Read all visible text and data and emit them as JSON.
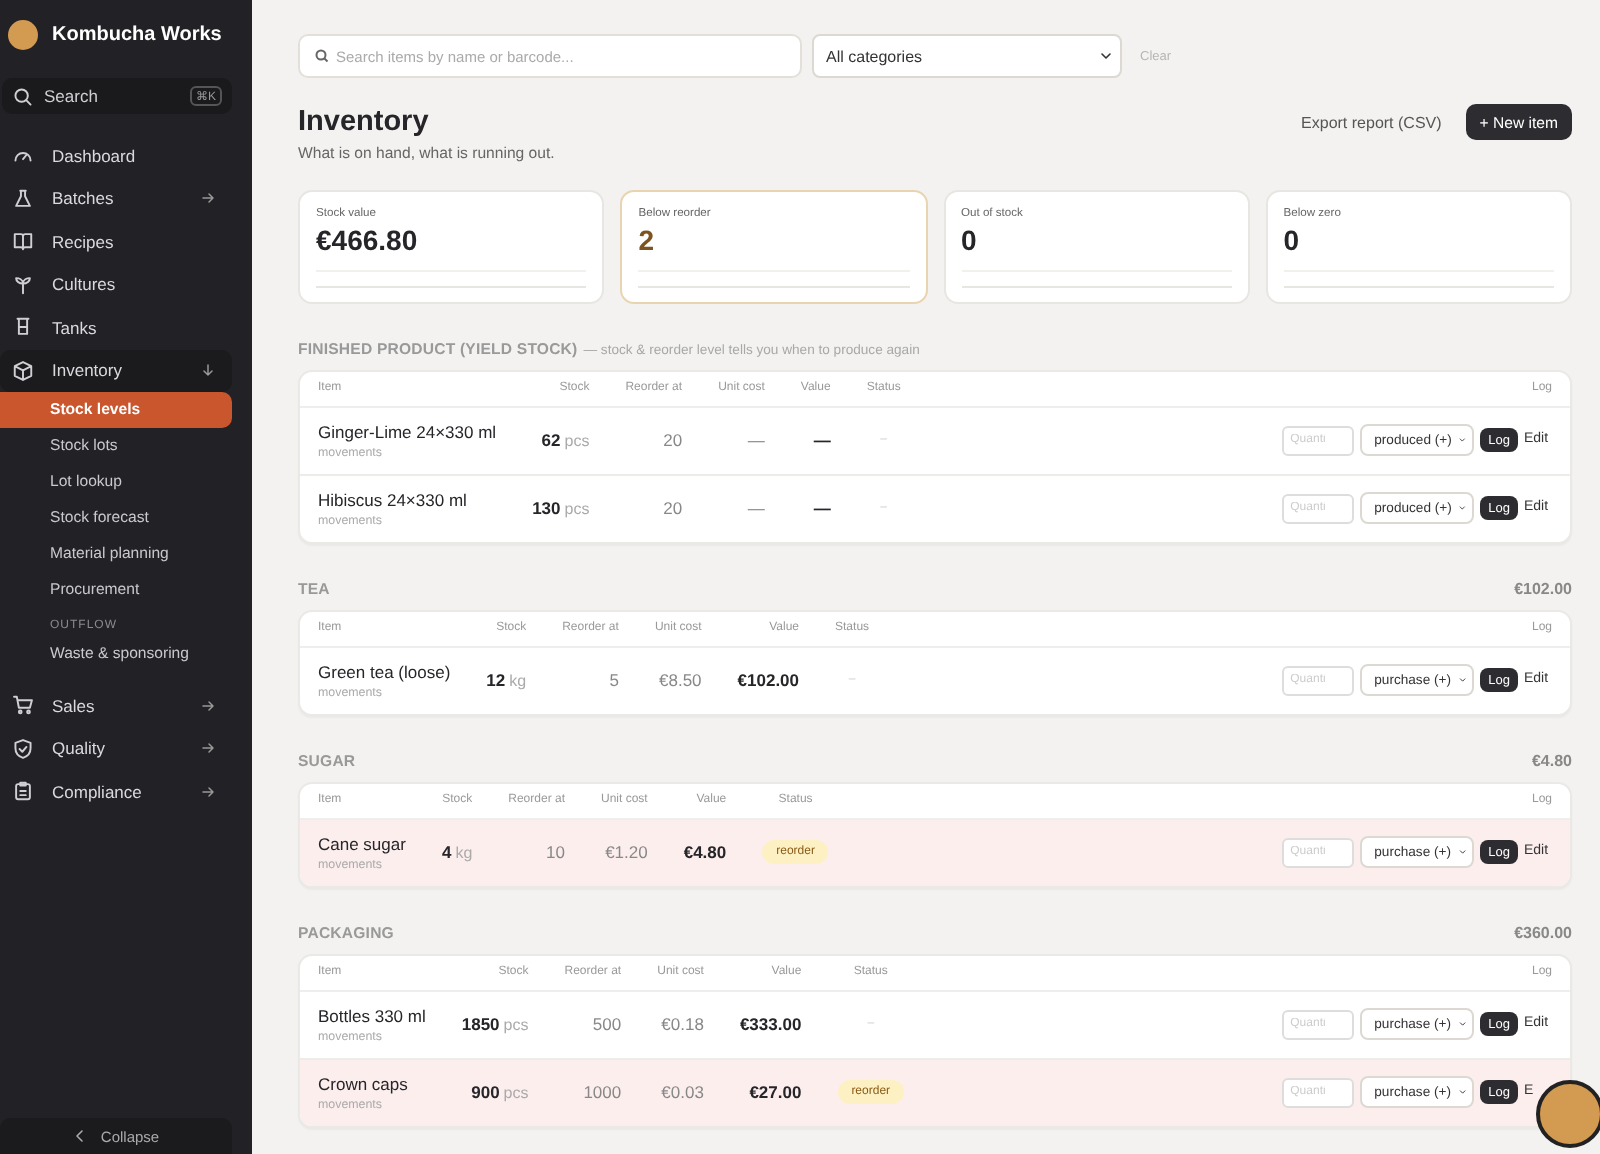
{
  "sidebar": {
    "brand": "Kombucha Works",
    "search": {
      "label": "Search",
      "shortcut": "⌘K"
    },
    "nav": [
      {
        "label": "Dashboard"
      },
      {
        "label": "Batches",
        "expanded": false
      },
      {
        "label": "Recipes"
      },
      {
        "label": "Cultures"
      },
      {
        "label": "Tanks"
      },
      {
        "label": "Inventory",
        "expanded": true,
        "children": [
          {
            "kind": "link",
            "label": "Stock levels",
            "selected": true
          },
          {
            "kind": "link",
            "label": "Stock lots",
            "selected": false
          },
          {
            "kind": "link",
            "label": "Lot lookup",
            "selected": false
          },
          {
            "kind": "link",
            "label": "Stock forecast",
            "selected": false
          },
          {
            "kind": "link",
            "label": "Material planning",
            "selected": false
          },
          {
            "kind": "link",
            "label": "Procurement",
            "selected": false
          },
          {
            "kind": "heading",
            "label": "OUTFLOW"
          },
          {
            "kind": "link",
            "label": "Waste & sponsoring",
            "selected": false
          }
        ]
      },
      {
        "label": "Sales",
        "expanded": false
      },
      {
        "label": "Quality",
        "expanded": false
      },
      {
        "label": "Compliance",
        "expanded": false
      }
    ],
    "collapse": "Collapse"
  },
  "filters": {
    "search": {
      "placeholder": "Search items by name or barcode..."
    },
    "category": "All categories",
    "clear": "Clear"
  },
  "header": {
    "title": "Inventory",
    "subtitle": "What is on hand, what is running out.",
    "export": "Export report (CSV)",
    "new_item": "+ New item"
  },
  "stats": [
    {
      "label": "Stock value",
      "value": "€466.80",
      "warn": false
    },
    {
      "label": "Below reorder",
      "value": "2",
      "warn": true
    },
    {
      "label": "Out of stock",
      "value": "0",
      "warn": false
    },
    {
      "label": "Below zero",
      "value": "0",
      "warn": false
    }
  ],
  "sections": [
    {
      "title": "FINISHED PRODUCT (YIELD STOCK)",
      "note": "— stock & reorder level tells you when to produce again",
      "columns": [
        "Item",
        "Stock",
        "Reorder at",
        "Unit cost",
        "Value",
        "Status",
        "Log"
      ],
      "rows": [
        {
          "name": "Ginger-Lime 24×330 ml",
          "sub": "movements",
          "stock": "62",
          "unit": "pcs",
          "reorder": "20",
          "unit_cost": "—",
          "value": "—",
          "status": {
            "kind": "none",
            "text": "–"
          },
          "alert": false,
          "qty_placeholder": "Quanti",
          "movement": "produced (+)",
          "log": "Log",
          "edit": "Edit"
        },
        {
          "name": "Hibiscus 24×330 ml",
          "sub": "movements",
          "stock": "130",
          "unit": "pcs",
          "reorder": "20",
          "unit_cost": "—",
          "value": "—",
          "status": {
            "kind": "none",
            "text": "–"
          },
          "alert": false,
          "qty_placeholder": "Quanti",
          "movement": "produced (+)",
          "log": "Log",
          "edit": "Edit"
        }
      ]
    },
    {
      "title": "TEA",
      "total": "€102.00",
      "columns": [
        "Item",
        "Stock",
        "Reorder at",
        "Unit cost",
        "Value",
        "Status",
        "Log"
      ],
      "rows": [
        {
          "name": "Green tea (loose)",
          "sub": "movements",
          "stock": "12",
          "unit": "kg",
          "reorder": "5",
          "unit_cost": "€8.50",
          "value": "€102.00",
          "status": {
            "kind": "none",
            "text": "–"
          },
          "alert": false,
          "qty_placeholder": "Quanti",
          "movement": "purchase (+)",
          "log": "Log",
          "edit": "Edit"
        }
      ]
    },
    {
      "title": "SUGAR",
      "total": "€4.80",
      "columns": [
        "Item",
        "Stock",
        "Reorder at",
        "Unit cost",
        "Value",
        "Status",
        "Log"
      ],
      "rows": [
        {
          "name": "Cane sugar",
          "sub": "movements",
          "stock": "4",
          "unit": "kg",
          "reorder": "10",
          "unit_cost": "€1.20",
          "value": "€4.80",
          "status": {
            "kind": "badge",
            "text": "reorder"
          },
          "alert": true,
          "qty_placeholder": "Quanti",
          "movement": "purchase (+)",
          "log": "Log",
          "edit": "Edit"
        }
      ]
    },
    {
      "title": "PACKAGING",
      "total": "€360.00",
      "columns": [
        "Item",
        "Stock",
        "Reorder at",
        "Unit cost",
        "Value",
        "Status",
        "Log"
      ],
      "rows": [
        {
          "name": "Bottles 330 ml",
          "sub": "movements",
          "stock": "1850",
          "unit": "pcs",
          "reorder": "500",
          "unit_cost": "€0.18",
          "value": "€333.00",
          "status": {
            "kind": "none",
            "text": "–"
          },
          "alert": false,
          "qty_placeholder": "Quanti",
          "movement": "purchase (+)",
          "log": "Log",
          "edit": "Edit"
        },
        {
          "name": "Crown caps",
          "sub": "movements",
          "stock": "900",
          "unit": "pcs",
          "reorder": "1000",
          "unit_cost": "€0.03",
          "value": "€27.00",
          "status": {
            "kind": "badge",
            "text": "reorder"
          },
          "alert": true,
          "qty_placeholder": "Quanti",
          "movement": "purchase (+)",
          "log": "Log",
          "edit": "E"
        }
      ]
    }
  ]
}
